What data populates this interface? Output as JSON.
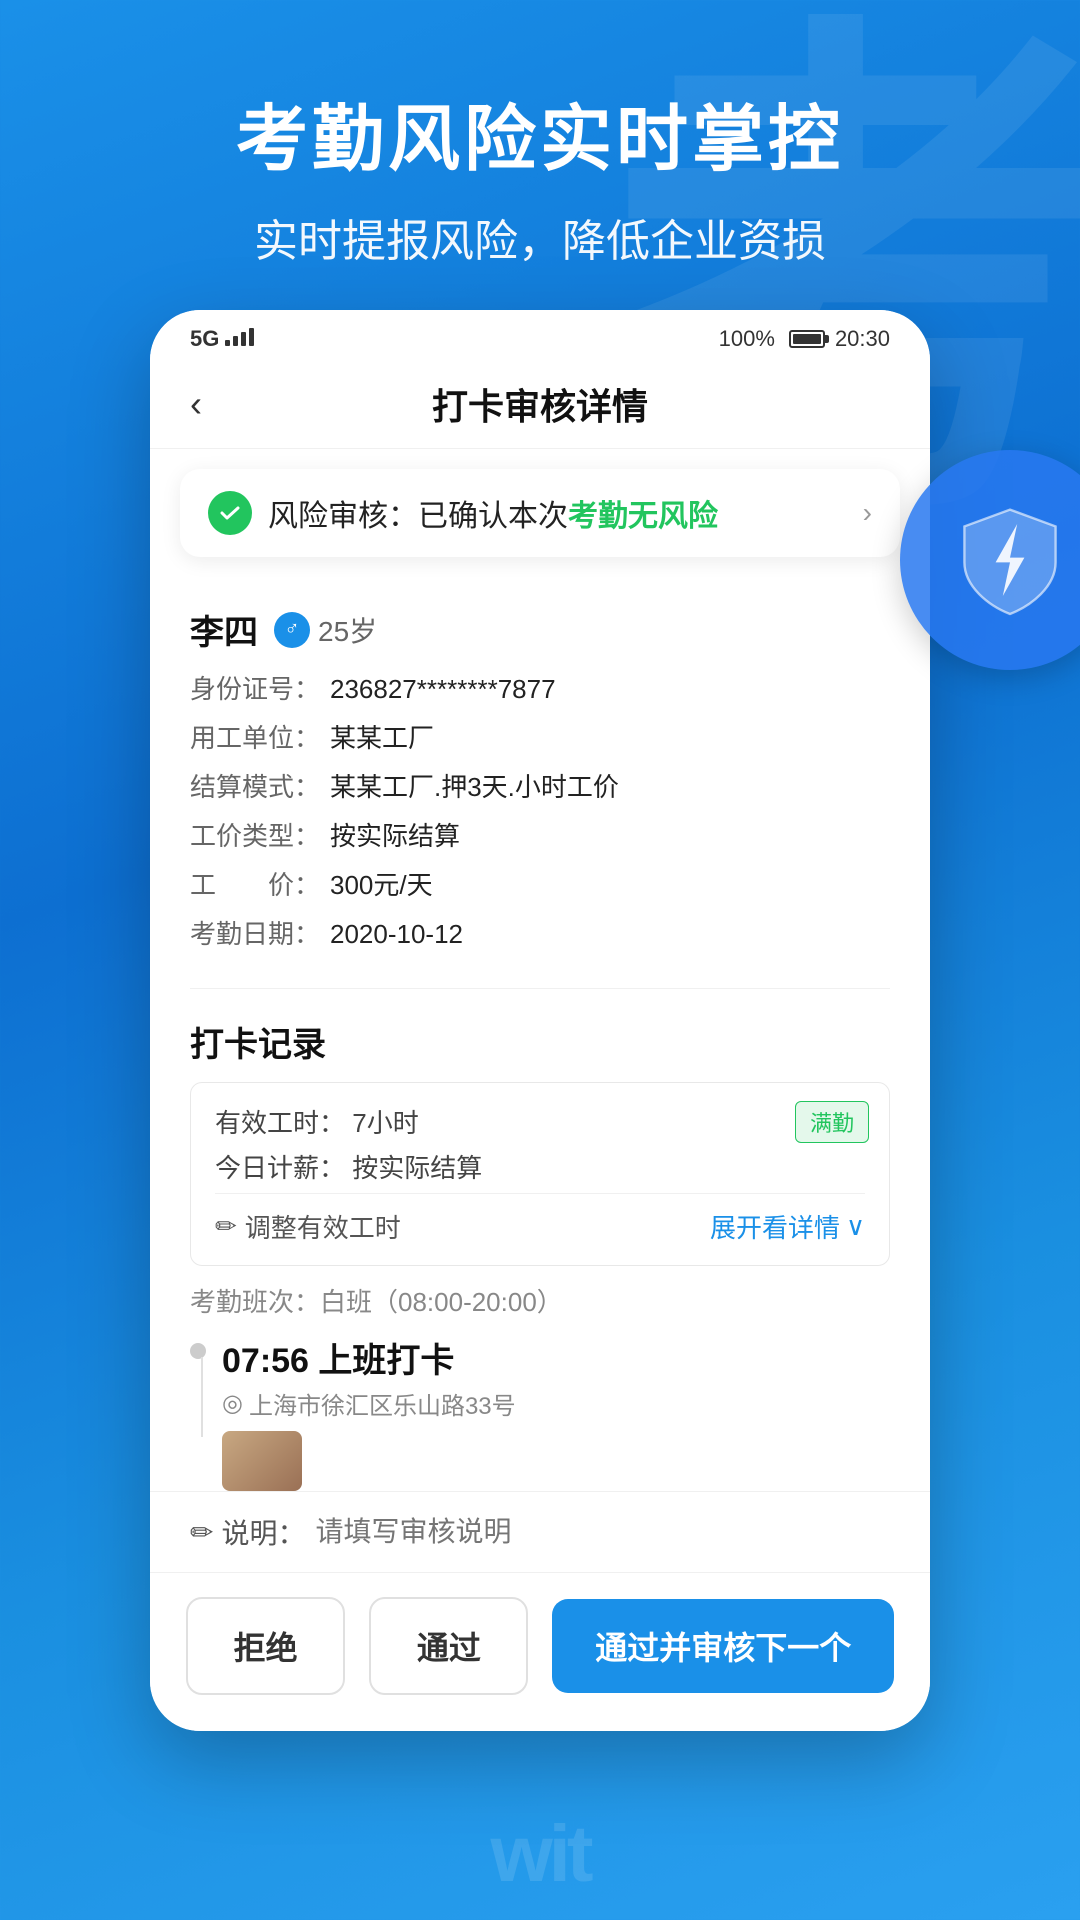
{
  "background": {
    "bg_char": "考"
  },
  "hero": {
    "title": "考勤风险实时掌控",
    "subtitle": "实时提报风险，降低企业资损"
  },
  "status_bar": {
    "signal": "5G",
    "battery_percent": "100%",
    "time": "20:30"
  },
  "nav": {
    "back_icon": "‹",
    "title": "打卡审核详情"
  },
  "risk_banner": {
    "icon_check": "✓",
    "text_prefix": "风险审核：已确认本次",
    "text_highlight": "考勤无风险",
    "arrow": "›"
  },
  "user_info": {
    "name": "李四",
    "gender_icon": "♂",
    "age": "25岁",
    "fields": [
      {
        "label": "身份证号：",
        "value": "236827********7877"
      },
      {
        "label": "用工单位：",
        "value": "某某工厂"
      },
      {
        "label": "结算模式：",
        "value": "某某工厂.押3天.小时工价"
      },
      {
        "label": "工价类型：",
        "value": "按实际结算"
      },
      {
        "label": "工　　价：",
        "value": "300元/天"
      },
      {
        "label": "考勤日期：",
        "value": "2020-10-12"
      }
    ]
  },
  "clock_section": {
    "title": "打卡记录",
    "effective_hours_label": "有效工时：",
    "effective_hours_value": "7小时",
    "full_attendance_badge": "满勤",
    "daily_salary_label": "今日计薪：",
    "daily_salary_value": "按实际结算",
    "adjust_label": "调整有效工时",
    "expand_label": "展开看详情",
    "expand_icon": "∨",
    "edit_icon": "✏",
    "shift_label": "考勤班次：白班（08:00-20:00）",
    "clock_in": {
      "time": "07:56",
      "action": "上班打卡",
      "location_icon": "◎",
      "location": "上海市徐汇区乐山路33号"
    }
  },
  "description": {
    "edit_icon": "✏",
    "label": "说明：",
    "placeholder": "请填写审核说明"
  },
  "buttons": {
    "reject": "拒绝",
    "pass": "通过",
    "pass_next": "通过并审核下一个"
  },
  "shield": {
    "aria": "security-shield-icon"
  },
  "watermark": {
    "text": "wit"
  }
}
